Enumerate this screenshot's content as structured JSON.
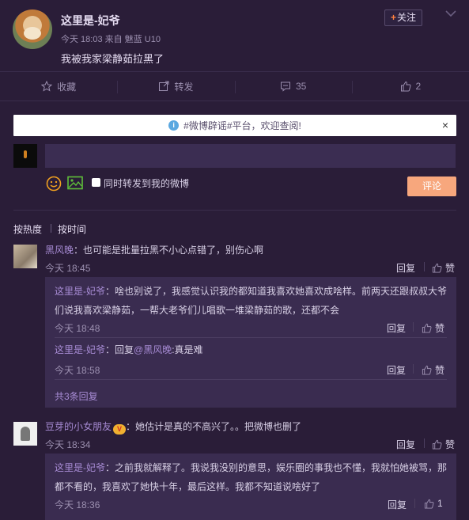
{
  "post": {
    "username": "这里是-妃爷",
    "time": "今天 18:03",
    "source_prefix": "来自",
    "source": "魅蓝 U10",
    "text": "我被我家梁静茹拉黑了",
    "follow_label": "关注"
  },
  "actions": {
    "favorite": "收藏",
    "repost": "转发",
    "comment_count": "35",
    "like_count": "2"
  },
  "notice": {
    "text": "#微博辟谣#平台，欢迎查阅!",
    "close": "×"
  },
  "composer": {
    "input_value": "",
    "repost_label": "同时转发到我的微博",
    "submit_label": "评论"
  },
  "sort": {
    "hot": "按热度",
    "time": "按时间"
  },
  "comments": [
    {
      "user": "黑风晚",
      "text": "：也可能是批量拉黑不小心点错了，别伤心啊",
      "time": "今天 18:45",
      "reply": "回复",
      "like": "赞",
      "replies": [
        {
          "user": "这里是-妃爷",
          "text": "：啥也别说了，我感觉认识我的都知道我喜欢她喜欢成啥样。前两天还跟叔叔大爷们说我喜欢梁静茹，一帮大老爷们儿唱歌一堆梁静茹的歌，还都不会",
          "time": "今天 18:48",
          "reply": "回复",
          "like": "赞"
        },
        {
          "user": "这里是-妃爷",
          "pre": "：回复",
          "at": "@黑风晚",
          "text": ":真是难",
          "time": "今天 18:58",
          "reply": "回复",
          "like": "赞"
        }
      ],
      "more": "共3条回复"
    },
    {
      "user": "豆芽的小女朋友",
      "badge": "V",
      "text": "：她估计是真的不高兴了。。把微博也删了",
      "time": "今天 18:34",
      "reply": "回复",
      "like": "赞",
      "replies": [
        {
          "user": "这里是-妃爷",
          "text": "：之前我就解释了。我说我没别的意思，娱乐圈的事我也不懂，我就怕她被骂，那都不看的，我喜欢了她快十年，最后这样。我都不知道说啥好了",
          "time": "今天 18:36",
          "reply": "回复",
          "like": "1"
        }
      ]
    }
  ],
  "colors": {
    "background": "#2a1d38",
    "accent_link": "#a78bd4",
    "submit": "#f7a77d",
    "follow_plus": "#ff8140"
  }
}
